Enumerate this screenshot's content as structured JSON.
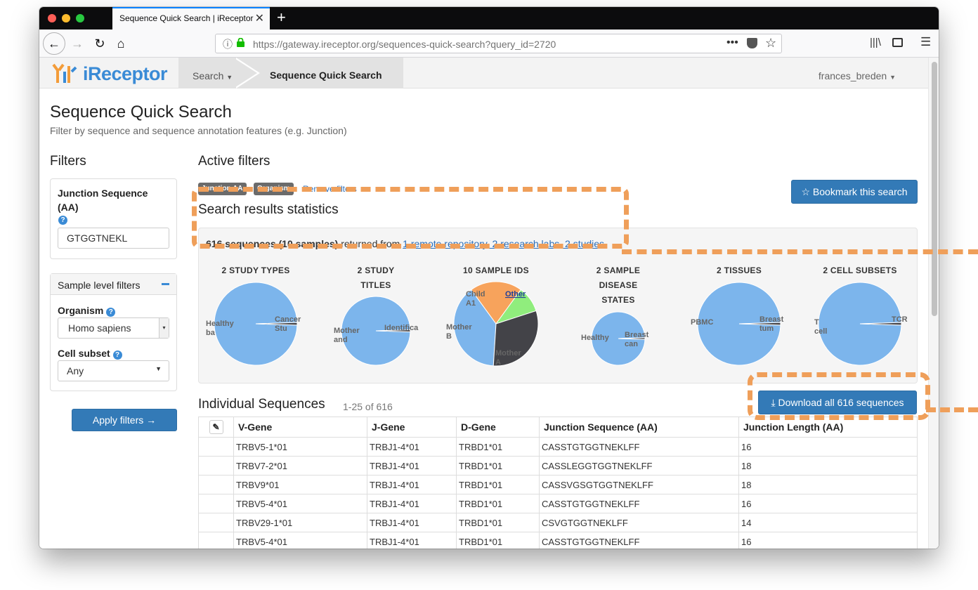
{
  "browser": {
    "tab_title": "Sequence Quick Search | iReceptor",
    "url": "https://gateway.ireceptor.org/sequences-quick-search?query_id=2720"
  },
  "nav": {
    "logo_text": "iReceptor",
    "search_label": "Search",
    "current_label": "Sequence Quick Search",
    "user": "frances_breden"
  },
  "page": {
    "title": "Sequence Quick Search",
    "subtitle": "Filter by sequence and sequence annotation features (e.g. Junction)"
  },
  "filters": {
    "heading": "Filters",
    "junction_label": "Junction Sequence (AA)",
    "junction_value": "GTGGTNEKL",
    "sample_level_label": "Sample level filters",
    "organism_label": "Organism",
    "organism_value": "Homo sapiens",
    "cell_subset_label": "Cell subset",
    "cell_subset_value": "Any",
    "apply_label": "Apply filters →"
  },
  "active_filters": {
    "heading": "Active filters",
    "badges": [
      "Junction AA",
      "Organism"
    ],
    "remove_label": "Remove filters",
    "bookmark_label": "☆ Bookmark this search"
  },
  "stats": {
    "heading": "Search results statistics",
    "summary_bold": "616 sequences (10 samples)",
    "summary_mid": " returned from ",
    "summary_link": "1 remote repository, 2 research labs, 2 studies"
  },
  "chart_data": [
    {
      "type": "pie",
      "title": "2 STUDY TYPES",
      "labels": [
        "Healthy ba",
        "Cancer Stu"
      ],
      "values": [
        99,
        1
      ]
    },
    {
      "type": "pie",
      "title": "2 STUDY TITLES",
      "labels": [
        "Mother and",
        "Identifica"
      ],
      "values": [
        99,
        1
      ]
    },
    {
      "type": "pie",
      "title": "10 SAMPLE IDS",
      "labels": [
        "Mother A",
        "Mother B",
        "Child A1",
        "Other"
      ],
      "values": [
        39,
        20,
        10,
        31
      ]
    },
    {
      "type": "pie",
      "title": "2 SAMPLE DISEASE STATES",
      "labels": [
        "Healthy",
        "Breast can"
      ],
      "values": [
        99,
        1
      ]
    },
    {
      "type": "pie",
      "title": "2 TISSUES",
      "labels": [
        "PBMC",
        "Breast tum"
      ],
      "values": [
        99,
        1
      ]
    },
    {
      "type": "pie",
      "title": "2 CELL SUBSETS",
      "labels": [
        "T cell",
        "TCR"
      ],
      "values": [
        99,
        1
      ]
    }
  ],
  "sequences": {
    "heading": "Individual Sequences",
    "count": "1-25 of 616",
    "download_label": "Download all 616 sequences",
    "columns": [
      "V-Gene",
      "J-Gene",
      "D-Gene",
      "Junction Sequence (AA)",
      "Junction Length (AA)"
    ],
    "rows": [
      [
        "TRBV5-1*01",
        "TRBJ1-4*01",
        "TRBD1*01",
        "CASSTGTGGTNEKLFF",
        "16"
      ],
      [
        "TRBV7-2*01",
        "TRBJ1-4*01",
        "TRBD1*01",
        "CASSLEGGTGGTNEKLFF",
        "18"
      ],
      [
        "TRBV9*01",
        "TRBJ1-4*01",
        "TRBD1*01",
        "CASSVGSGTGGTNEKLFF",
        "18"
      ],
      [
        "TRBV5-4*01",
        "TRBJ1-4*01",
        "TRBD1*01",
        "CASSTGTGGTNEKLFF",
        "16"
      ],
      [
        "TRBV29-1*01",
        "TRBJ1-4*01",
        "TRBD1*01",
        "CSVGTGGTNEKLFF",
        "14"
      ],
      [
        "TRBV5-4*01",
        "TRBJ1-4*01",
        "TRBD1*01",
        "CASSTGTGGTNEKLFF",
        "16"
      ]
    ]
  },
  "colors": {
    "accent": "#337ab7",
    "pie_blue": "#7cb5ec",
    "pie_dark": "#434348",
    "pie_green": "#90ed7d",
    "pie_orange": "#f7a35c",
    "highlight": "#ef9f5a"
  }
}
